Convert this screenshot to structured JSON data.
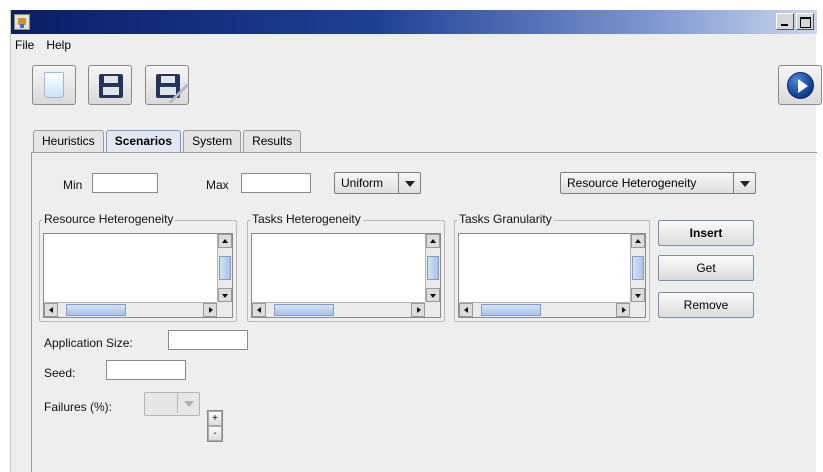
{
  "menu": {
    "file": "File",
    "help": "Help"
  },
  "tabs": [
    {
      "label": "Heuristics",
      "active": false
    },
    {
      "label": "Scenarios",
      "active": true
    },
    {
      "label": "System",
      "active": false
    },
    {
      "label": "Results",
      "active": false
    }
  ],
  "scenario": {
    "min_label": "Min",
    "min_value": "",
    "max_label": "Max",
    "max_value": "",
    "distribution": {
      "selected": "Uniform"
    },
    "target": {
      "selected": "Resource Heterogeneity"
    },
    "groups": [
      {
        "title": "Resource Heterogeneity"
      },
      {
        "title": "Tasks Heterogeneity"
      },
      {
        "title": "Tasks Granularity"
      }
    ],
    "buttons": {
      "insert": "Insert",
      "get": "Get",
      "remove": "Remove"
    },
    "application_size_label": "Application Size:",
    "application_size_value": "",
    "seed_label": "Seed:",
    "seed_value": "",
    "failures_label": "Failures (%):",
    "failures_selected": "",
    "spin_up": "+",
    "spin_down": "-"
  },
  "icons": [
    "app-icon",
    "open-file-icon",
    "save-icon",
    "save-as-icon",
    "run-icon"
  ]
}
